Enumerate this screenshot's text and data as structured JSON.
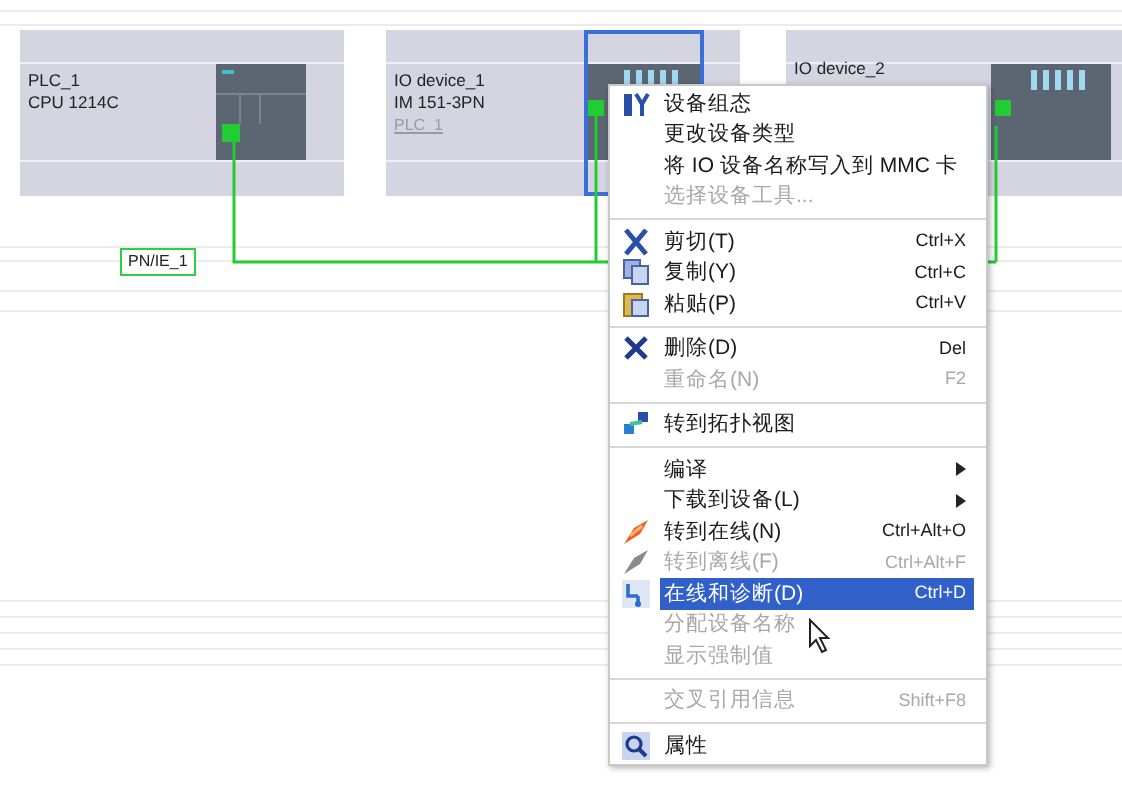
{
  "devices": [
    {
      "name": "PLC_1",
      "type": "CPU 1214C",
      "selected": false,
      "kind": "cpu"
    },
    {
      "name": "IO device_1",
      "type": "IM 151-3PN",
      "assigned": "PLC_1",
      "selected": true,
      "kind": "io"
    },
    {
      "name": "IO device_2",
      "selected": false,
      "kind": "io"
    }
  ],
  "network": {
    "label": "PN/IE_1"
  },
  "context_menu": {
    "groups": [
      [
        {
          "kind": "config",
          "label": "设备组态",
          "disabled": false,
          "selected": false,
          "submenu": false
        },
        {
          "kind": "plain",
          "label": "更改设备类型",
          "disabled": false,
          "selected": false,
          "submenu": false
        },
        {
          "kind": "plain",
          "label": "将 IO 设备名称写入到 MMC 卡",
          "disabled": false,
          "selected": false,
          "submenu": false
        },
        {
          "kind": "plain",
          "label": "选择设备工具...",
          "disabled": true,
          "selected": false,
          "submenu": false
        }
      ],
      [
        {
          "kind": "cut",
          "label": "剪切(T)",
          "shortcut": "Ctrl+X",
          "disabled": false,
          "selected": false,
          "submenu": false
        },
        {
          "kind": "copy",
          "label": "复制(Y)",
          "shortcut": "Ctrl+C",
          "disabled": false,
          "selected": false,
          "submenu": false
        },
        {
          "kind": "paste",
          "label": "粘贴(P)",
          "shortcut": "Ctrl+V",
          "disabled": false,
          "selected": false,
          "submenu": false
        }
      ],
      [
        {
          "kind": "delete",
          "label": "删除(D)",
          "shortcut": "Del",
          "disabled": false,
          "selected": false,
          "submenu": false
        },
        {
          "kind": "plain",
          "label": "重命名(N)",
          "shortcut": "F2",
          "disabled": true,
          "selected": false,
          "submenu": false
        }
      ],
      [
        {
          "kind": "topology",
          "label": "转到拓扑视图",
          "disabled": false,
          "selected": false,
          "submenu": false
        }
      ],
      [
        {
          "kind": "plain",
          "label": "编译",
          "disabled": false,
          "selected": false,
          "submenu": true
        },
        {
          "kind": "plain",
          "label": "下载到设备(L)",
          "disabled": false,
          "selected": false,
          "submenu": true
        },
        {
          "kind": "online",
          "label": "转到在线(N)",
          "shortcut": "Ctrl+Alt+O",
          "disabled": false,
          "selected": false,
          "submenu": false
        },
        {
          "kind": "offline",
          "label": "转到离线(F)",
          "shortcut": "Ctrl+Alt+F",
          "disabled": true,
          "selected": false,
          "submenu": false
        },
        {
          "kind": "diagnose",
          "label": "在线和诊断(D)",
          "shortcut": "Ctrl+D",
          "disabled": false,
          "selected": true,
          "submenu": false
        },
        {
          "kind": "plain",
          "label": "分配设备名称",
          "disabled": true,
          "selected": false,
          "submenu": false
        },
        {
          "kind": "plain",
          "label": "显示强制值",
          "disabled": true,
          "selected": false,
          "submenu": false
        }
      ],
      [
        {
          "kind": "plain",
          "label": "交叉引用信息",
          "shortcut": "Shift+F8",
          "disabled": true,
          "selected": false,
          "submenu": false
        }
      ],
      [
        {
          "kind": "properties",
          "label": "属性",
          "disabled": false,
          "selected": false,
          "submenu": false
        }
      ]
    ]
  }
}
